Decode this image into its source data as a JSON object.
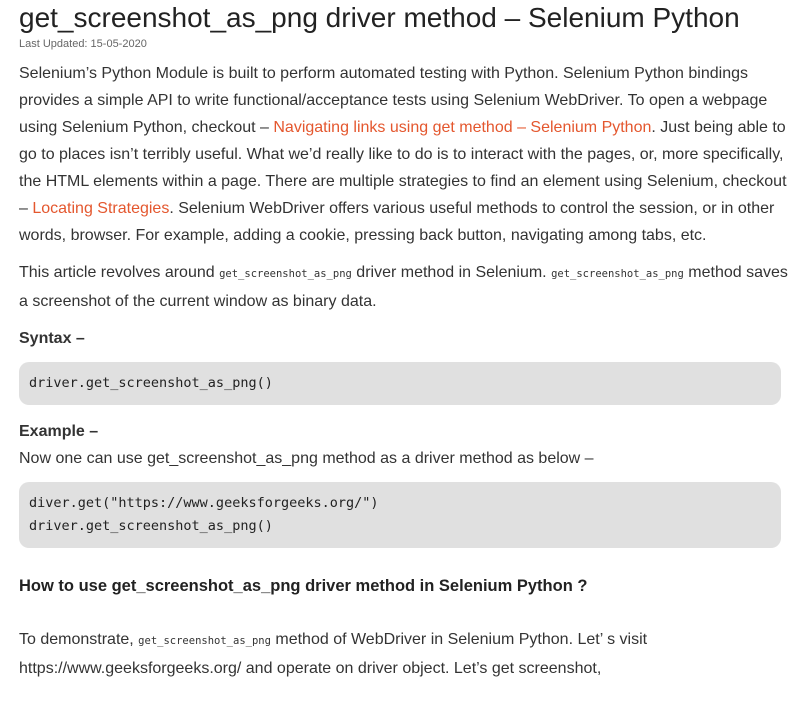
{
  "article": {
    "title": "get_screenshot_as_png driver method – Selenium Python",
    "last_updated": "Last Updated: 15-05-2020",
    "intro": {
      "text1": "Selenium’s Python Module is built to perform automated testing with Python. Selenium Python bindings provides a simple API to write functional/acceptance tests using Selenium WebDriver. To open a webpage using Selenium Python, checkout – ",
      "link1": "Navigating links using get method – Selenium Python",
      "text2": ". Just being able to go to places isn’t terribly useful. What we’d really like to do is to interact with the pages, or, more specifically, the HTML elements within a page. There are multiple strategies to find an element using Selenium, checkout – ",
      "link2": "Locating Strategies",
      "text3": ". Selenium WebDriver offers various useful methods to control the session, or in other words, browser. For example, adding a cookie, pressing back button, navigating among tabs, etc."
    },
    "about": {
      "text1": "This article revolves around ",
      "code1": "get_screenshot_as_png",
      "text2": " driver method in Selenium. ",
      "code2": "get_screenshot_as_png",
      "text3": " method saves a screenshot of the current window as binary data."
    },
    "syntax_label": "Syntax –",
    "syntax_code": [
      "driver.get_screenshot_as_png()"
    ],
    "example_label": "Example –",
    "example_text": "Now one can use get_screenshot_as_png method as a driver method as below –",
    "example_code": [
      "diver.get(\"https://www.geeksforgeeks.org/\")",
      "driver.get_screenshot_as_png()"
    ],
    "howto_heading": "How to use get_screenshot_as_png driver method in Selenium Python ?",
    "demo": {
      "text1": "To demonstrate, ",
      "code1": "get_screenshot_as_png",
      "text2": " method of WebDriver in Selenium Python. Let’ s visit https://www.geeksforgeeks.org/ and operate on driver object. Let’s get screenshot,"
    }
  },
  "colors": {
    "link": "#e4572e",
    "code_background": "#e0e0e0",
    "text": "#333333"
  }
}
